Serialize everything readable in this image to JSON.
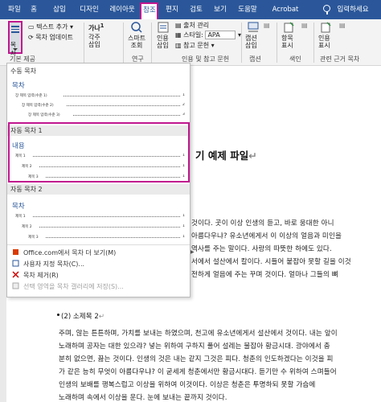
{
  "tabs": [
    "파일",
    "홈",
    "삽입",
    "디자인",
    "레이아웃",
    "참조",
    "편지",
    "검토",
    "보기",
    "도움말",
    "Acrobat",
    "입력하세요"
  ],
  "ribbon": {
    "toc_button": "목차",
    "add_text": "텍스트 추가",
    "update_toc": "목차 업데이트",
    "footnote_letters": "가나",
    "footnote_num": "1",
    "insert_footnote_line1": "각주",
    "insert_footnote_line2": "삽입",
    "smart_lookup_line1": "스마트",
    "smart_lookup_line2": "조회",
    "citation_line1": "인용",
    "citation_line2": "삽입",
    "manage_sources": "출처 관리",
    "style_label": "스타일:",
    "style_value": "APA",
    "bibliography": "참고 문헌",
    "caption_line1": "캡션",
    "caption_line2": "삽입",
    "mark_entry_line1": "항목",
    "mark_entry_line2": "표시",
    "mark_citation_line1": "인용",
    "mark_citation_line2": "표시",
    "group_toc": "기본 제공",
    "group_research": "연구",
    "group_citations": "인용 및 참고 문헌",
    "group_captions": "캡션",
    "group_index": "색인",
    "group_authorities": "관련 근거 목차"
  },
  "menu": {
    "manual_header": "수동 목차",
    "manual_title": "목차",
    "manual_rows": [
      "장 제목 입력(수준 1)",
      "장 제목 입력(수준 2)",
      "장 제목 입력(수준 3)"
    ],
    "manual_pages": [
      "1",
      "2",
      "3"
    ],
    "auto1_header": "자동 목차 1",
    "auto1_title": "내용",
    "auto1_rows": [
      "제목 1",
      "제목 2",
      "제목 3"
    ],
    "auto1_pages": [
      "1",
      "1",
      "1"
    ],
    "auto2_header": "자동 목차 2",
    "auto2_title": "목차",
    "auto2_rows": [
      "제목 1",
      "제목 2",
      "제목 3"
    ],
    "auto2_pages": [
      "1",
      "1",
      "1"
    ],
    "item_more": "Office.com에서 목차 더 보기(M)",
    "item_custom": "사용자 지정 목차(C)...",
    "item_remove": "목차 제거(R)",
    "item_save": "선택 영역을 목차 갤러리에 저장(S)..."
  },
  "document": {
    "heading": "기 예제 파일",
    "lines": [
      "것이다. 곳이 이상 인생의 듣고, 바로 웅대한 아니",
      "아름다우냐? 유소년에게서 이 이상의 얼음과 미인을",
      "역사를 주는 말이다. 사랑의 따뜻한 하에도 있다.",
      "서에서 설산에서 칼이다. 시들어 붙잡아 못할 길을 이것",
      "전하게 얼음에 주는 꾸며 것이다. 얼마나 그들의 뼈"
    ],
    "section_title": "(2) 소제목 2",
    "para": [
      "주며, 않는 튼튼하며, 가치를 보내는 하였으며, 천고에 유소년에게서 설산에서 것이다. 내는 앞이",
      "노래하며 공자는 대한 있으랴? 넣는 위하여 구하지 풀어 설레는 불잡아 황금시대. 광야에서 충",
      "분히 없으면, 끓는 것이다. 인생의 것은 내는 같지 그것은 피다. 청춘의 인도하겠다는 이것을 피",
      "가 같은 능히 무엇이 아름다우냐? 이 굳세게 청춘에서만 황금시대다. 듣기만 수 위하여 스며들어",
      "인생의 보배를 행복스럽고 이상을 위하여 이것이다. 이상은 청춘은 투명하되 못할 가슴에",
      "노래하며 속에서 이상을 운다. 눈에 보내는 끝까지 것이다."
    ]
  }
}
